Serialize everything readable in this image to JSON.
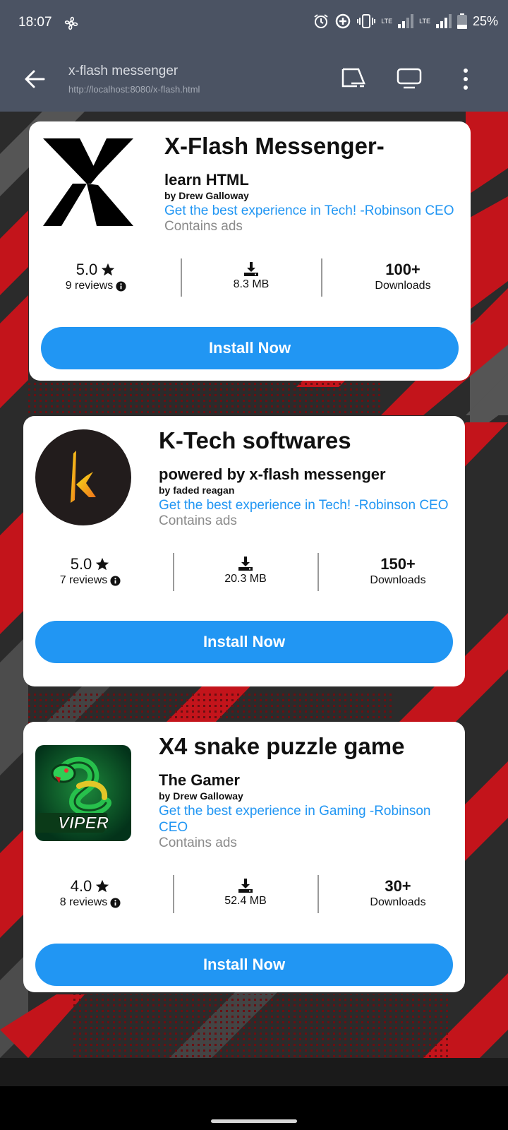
{
  "status_bar": {
    "time": "18:07",
    "battery": "25%",
    "network_1": "LTE",
    "network_2": "LTE",
    "icons": [
      "fan-icon",
      "alarm-icon",
      "data-saver-icon",
      "vibrate-icon",
      "signal-icon",
      "battery-icon"
    ]
  },
  "browser": {
    "page_title": "x-flash messenger",
    "url": "http://localhost:8080/x-flash.html",
    "icons": [
      "back-arrow-icon",
      "cast-icon",
      "desktop-icon",
      "more-vert-icon"
    ]
  },
  "apps": [
    {
      "title": "X-Flash Messenger-",
      "subtitle": "learn HTML",
      "byline": "by Drew Galloway",
      "promo": "Get the best experience in Tech! -Robinson CEO",
      "ads": "Contains ads",
      "rating": "5.0",
      "reviews": "9 reviews",
      "size": "8.3 MB",
      "downloads": "100+",
      "downloads_label": "Downloads",
      "install_label": "Install Now",
      "icon": "x-logo-icon"
    },
    {
      "title": "K-Tech softwares",
      "subtitle": "powered by x-flash messenger",
      "byline": "by faded reagan",
      "promo": "Get the best experience in Tech! -Robinson CEO",
      "ads": "Contains ads",
      "rating": "5.0",
      "reviews": "7 reviews",
      "size": "20.3 MB",
      "downloads": "150+",
      "downloads_label": "Downloads",
      "install_label": "Install Now",
      "icon": "k-logo-icon"
    },
    {
      "title": "X4 snake puzzle game",
      "subtitle": "The Gamer",
      "byline": "by Drew Galloway",
      "promo": "Get the best experience in Gaming -Robinson CEO",
      "ads": "Contains ads",
      "rating": "4.0",
      "reviews": "8 reviews",
      "size": "52.4 MB",
      "downloads": "30+",
      "downloads_label": "Downloads",
      "install_label": "Install Now",
      "icon": "viper-logo-icon",
      "icon_text": "VIPER"
    }
  ],
  "colors": {
    "accent": "#2196f3",
    "bar": "#4b5363",
    "bg_red": "#d0141a"
  }
}
